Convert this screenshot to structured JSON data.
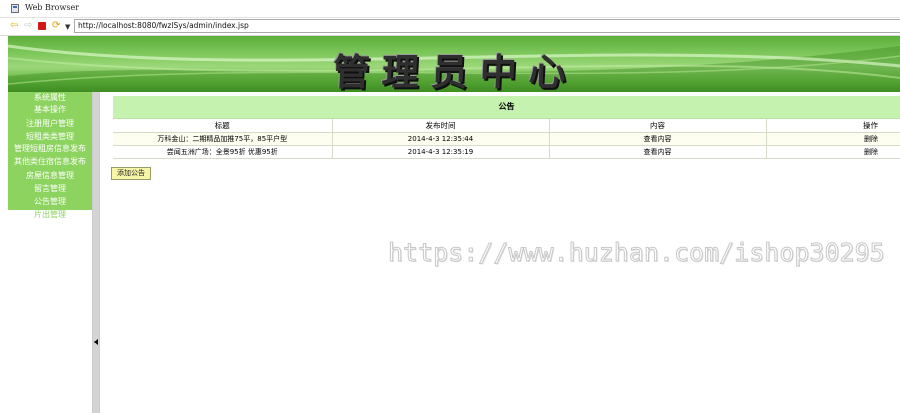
{
  "window": {
    "title": "Web Browser"
  },
  "toolbar": {
    "url": "http://localhost:8080/fwzlSys/admin/index.jsp"
  },
  "banner": {
    "title": "管理员中心"
  },
  "sidebar": {
    "items": [
      {
        "label": "系统属性"
      },
      {
        "label": "基本操作"
      },
      {
        "label": "注册用户管理"
      },
      {
        "label": "短租类类管理"
      },
      {
        "label": "管理短租房信息发布"
      },
      {
        "label": "其他类住宿信息发布"
      },
      {
        "label": "房屋信息管理"
      },
      {
        "label": "留言管理"
      },
      {
        "label": "公告管理"
      },
      {
        "label": "片出管理"
      }
    ]
  },
  "notice": {
    "caption": "公告",
    "columns": [
      "标题",
      "发布时间",
      "内容",
      "操作"
    ],
    "rows": [
      {
        "title": "万科金山：二期精品加推75平，85平户型",
        "time": "2014-4-3 12:35:44",
        "content": "查看内容",
        "action": "删除"
      },
      {
        "title": "尝闻五洲广场：全景95折 优惠95折",
        "time": "2014-4-3 12:35:19",
        "content": "查看内容",
        "action": "删除"
      }
    ],
    "add_button": "添加公告"
  },
  "watermark": {
    "text": "https://www.huzhan.com/ishop30295"
  },
  "colors": {
    "banner_green": "#7dc65a",
    "sidebar_green": "#8dd35f",
    "table_header": "#c6f2b0",
    "button_yellow": "#f7f5a8"
  }
}
